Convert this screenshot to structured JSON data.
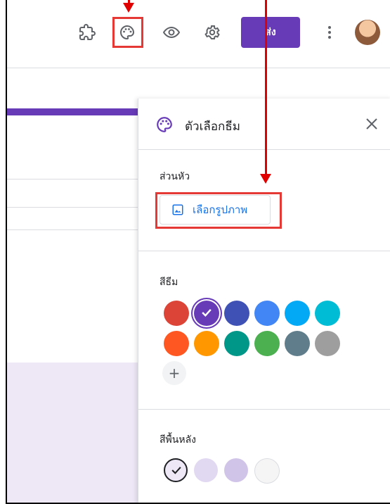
{
  "toolbar": {
    "send_label": "ส่ง",
    "icons": [
      "puzzle-icon",
      "palette-icon",
      "eye-icon",
      "gear-icon",
      "more-vert-icon"
    ]
  },
  "panel": {
    "title": "ตัวเลือกธีม",
    "header_section_label": "ส่วนหัว",
    "choose_image_label": "เลือกรูปภาพ",
    "theme_color_label": "สีธีม",
    "add_label": "+",
    "background_color_label": "สีพื้นหลัง",
    "theme_colors": [
      "#db4437",
      "#673ab7",
      "#3f51b5",
      "#4285f4",
      "#03a9f4",
      "#00bcd4",
      "#ff5722",
      "#ff9800",
      "#009688",
      "#4caf50",
      "#607d8b",
      "#9e9e9e"
    ],
    "selected_theme_color": "#673ab7",
    "background_colors": [
      "#ede7f6",
      "#e1d8f1",
      "#d1c4e9",
      "#f5f5f5"
    ],
    "selected_background_color": "#ede7f6"
  }
}
